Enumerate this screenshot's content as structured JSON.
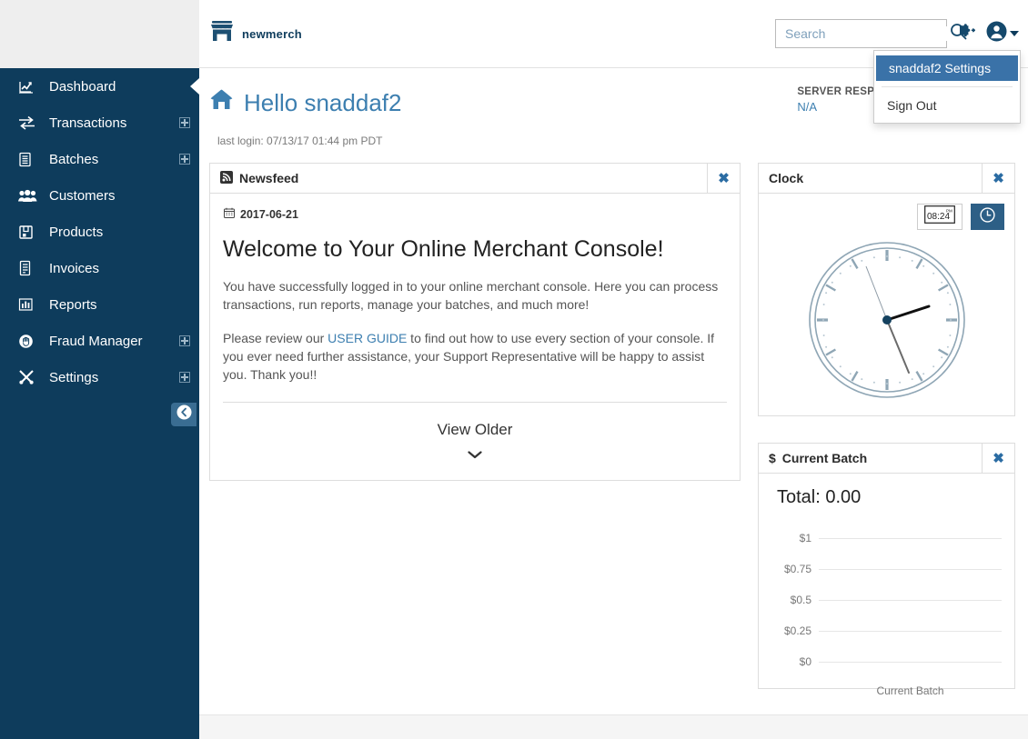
{
  "sidebar": {
    "items": [
      {
        "label": "Dashboard",
        "icon": "chart-line-icon",
        "expandable": false,
        "active": true
      },
      {
        "label": "Transactions",
        "icon": "exchange-icon",
        "expandable": true,
        "active": false
      },
      {
        "label": "Batches",
        "icon": "layers-icon",
        "expandable": true,
        "active": false
      },
      {
        "label": "Customers",
        "icon": "users-icon",
        "expandable": false,
        "active": false
      },
      {
        "label": "Products",
        "icon": "box-icon",
        "expandable": false,
        "active": false
      },
      {
        "label": "Invoices",
        "icon": "file-lines-icon",
        "expandable": false,
        "active": false
      },
      {
        "label": "Reports",
        "icon": "bar-chart-icon",
        "expandable": false,
        "active": false
      },
      {
        "label": "Fraud Manager",
        "icon": "hand-stop-icon",
        "expandable": true,
        "active": false
      },
      {
        "label": "Settings",
        "icon": "tools-icon",
        "expandable": true,
        "active": false
      }
    ],
    "collapse_icon": "arrow-circle-left-icon"
  },
  "topbar": {
    "brand_name": "newmerch",
    "brand_icon": "store-icon",
    "search": {
      "placeholder": "Search",
      "value": "",
      "icon": "search-icon"
    },
    "plugin_icon": "puzzle-piece-icon",
    "user_icon": "user-circle-icon",
    "caret_icon": "chevron-down-icon"
  },
  "user_menu": {
    "open": true,
    "items": [
      {
        "label": "snaddaf2 Settings",
        "selected": true
      },
      {
        "label": "Sign Out",
        "selected": false
      }
    ],
    "highlight_color": "#3a72a8"
  },
  "header": {
    "greeting": "Hello snaddaf2",
    "home_icon": "home-icon",
    "last_login": "last login: 07/13/17 01:44 pm PDT",
    "server_response_label": "SERVER RESPONSE",
    "server_response_value": "N/A"
  },
  "newsfeed": {
    "title": "Newsfeed",
    "icon": "rss-icon",
    "close_icon": "close-icon",
    "date": "2017-06-21",
    "date_icon": "calendar-icon",
    "headline": "Welcome to Your Online Merchant Console!",
    "paragraph1": "You have successfully logged in to your online merchant console. Here you can process transactions, run reports, manage your batches, and much more!",
    "paragraph2_before": "Please review our ",
    "paragraph2_link": "USER GUIDE",
    "paragraph2_after": " to find out how to use every section of your console. If you ever need further assistance, your Support Representative will be happy to assist you. Thank you!!",
    "view_older": "View Older",
    "view_older_icon": "chevron-down-icon"
  },
  "clock": {
    "title": "Clock",
    "close_icon": "close-icon",
    "digital_button_icon": "digital-clock-icon",
    "digital_button_time": "08:24",
    "digital_button_ampm": "PM",
    "analog_button_icon": "analog-clock-icon",
    "analog_button_active": true,
    "hands": {
      "hour_deg": 72,
      "minute_deg": 160,
      "second_deg": 341
    }
  },
  "current_batch": {
    "title": "Current Batch",
    "title_icon": "dollar-icon",
    "close_icon": "close-icon",
    "total_label": "Total: 0.00"
  },
  "chart_data": {
    "type": "bar",
    "title": "Current Batch",
    "categories": [
      "Current Batch"
    ],
    "values": [
      0
    ],
    "xlabel": "Current Batch",
    "ylabel": "",
    "ylim": [
      0,
      1
    ],
    "ytick_labels": [
      "$1",
      "$0.75",
      "$0.5",
      "$0.25",
      "$0"
    ],
    "ytick_values": [
      1,
      0.75,
      0.5,
      0.25,
      0
    ],
    "grid": true,
    "legend": false
  },
  "colors": {
    "sidebar_bg": "#0e3c5c",
    "brand": "#0e3c5c",
    "accent": "#3d7fb0",
    "panel_border": "#dddddd",
    "menu_highlight": "#3a72a8"
  }
}
